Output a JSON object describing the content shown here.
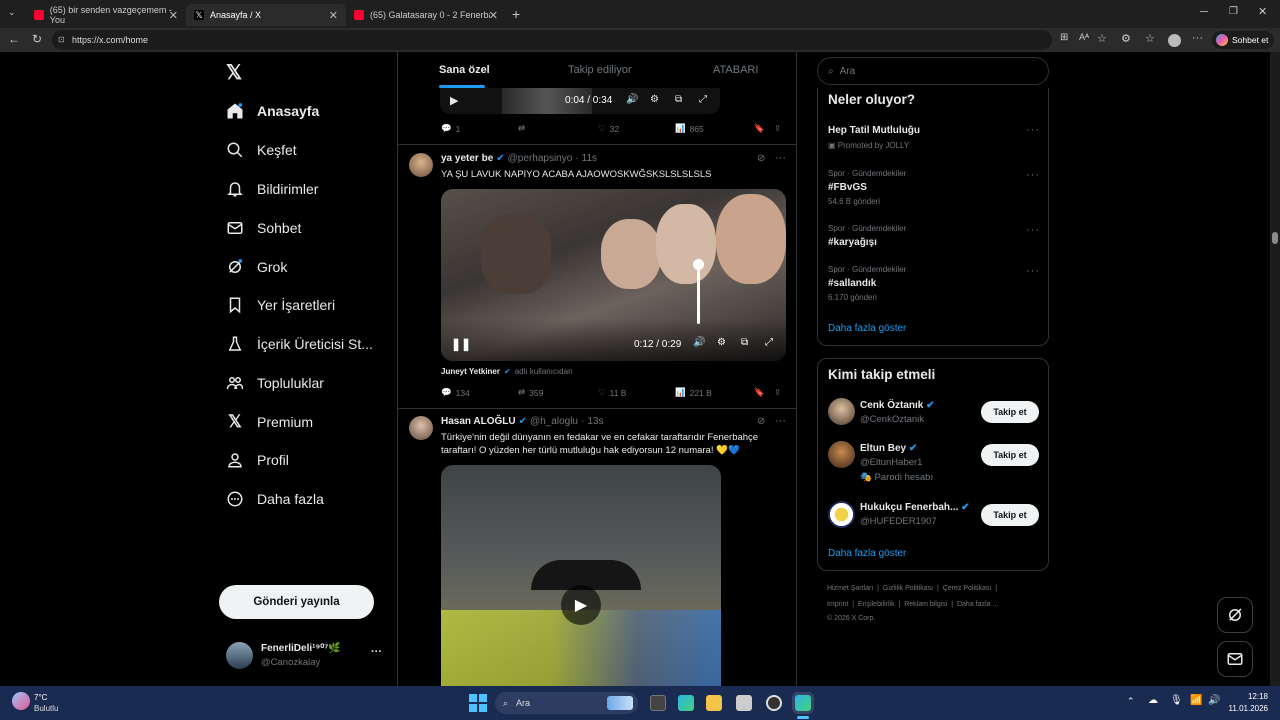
{
  "browser": {
    "tabs": [
      {
        "title": "(65) bir senden vazgeçemem - You",
        "active": false
      },
      {
        "title": "Anasayfa / X",
        "active": true
      },
      {
        "title": "(65) Galatasaray 0 - 2 Fenerbahçe",
        "active": false
      }
    ],
    "url": "https://x.com/home",
    "profile_button": "Sohbet et"
  },
  "nav": {
    "items": [
      {
        "label": "Anasayfa",
        "icon": "home-icon"
      },
      {
        "label": "Keşfet",
        "icon": "search-icon"
      },
      {
        "label": "Bildirimler",
        "icon": "bell-icon"
      },
      {
        "label": "Sohbet",
        "icon": "mail-icon"
      },
      {
        "label": "Grok",
        "icon": "grok-icon"
      },
      {
        "label": "Yer İşaretleri",
        "icon": "bookmark-icon"
      },
      {
        "label": "İçerik Üreticisi St...",
        "icon": "flask-icon"
      },
      {
        "label": "Topluluklar",
        "icon": "people-icon"
      },
      {
        "label": "Premium",
        "icon": "x-logo-icon"
      },
      {
        "label": "Profil",
        "icon": "person-icon"
      },
      {
        "label": "Daha fazla",
        "icon": "more-circle-icon"
      }
    ],
    "post_button": "Gönderi yayınla",
    "account": {
      "name": "FenerliDeli¹⁹⁰⁷🌿",
      "handle": "@Canozkalay"
    }
  },
  "timeline": {
    "tabs": [
      "Sana özel",
      "Takip ediliyor",
      "ATABARI"
    ],
    "top_player": {
      "time": "0:04 / 0:34"
    },
    "top_actions": {
      "replies": "1",
      "retweets": "",
      "likes": "32",
      "views": "865"
    },
    "post1": {
      "name": "ya yeter be",
      "handle": "@perhapsinyo",
      "time": "11s",
      "text": "YA ŞU LAVUK NAPIYO ACABA AJAOWOSKWĞSKSLSLSLSLS",
      "video_time": "0:12 / 0:29",
      "attribution_name": "Juneyt Yetkiner",
      "attribution_suffix": "adlı kullanıcıdan",
      "replies": "134",
      "retweets": "359",
      "likes": "11 B",
      "views": "221 B"
    },
    "post2": {
      "name": "Hasan ALOĞLU",
      "handle": "@h_aloglu",
      "time": "13s",
      "text": "Türkiye'nin değil dünyanın en fedakar ve en cefakar taraftarıdır Fenerbahçe taraftarı! O yüzden her türlü mutluluğu hak ediyorsun 12 numara! 💛💙"
    }
  },
  "sidebar": {
    "search_placeholder": "Ara",
    "trends_title": "Neler oluyor?",
    "trends": [
      {
        "context": "",
        "name": "Hep Tatil Mutluluğu",
        "meta": "Promoted by JOLLY"
      },
      {
        "context": "Spor · Gündemdekiler",
        "name": "#FBvGS",
        "meta": "54,6 B gönderi"
      },
      {
        "context": "Spor · Gündemdekiler",
        "name": "#karyağışı",
        "meta": ""
      },
      {
        "context": "Spor · Gündemdekiler",
        "name": "#sallandık",
        "meta": "6.170 gönderi"
      }
    ],
    "show_more": "Daha fazla göster",
    "who_title": "Kimi takip etmeli",
    "who": [
      {
        "name": "Cenk Öztanık",
        "handle": "@CenkOztanik",
        "note": "",
        "button": "Takip et"
      },
      {
        "name": "Eltun Bey",
        "handle": "@EltunHaber1",
        "note": "Parodi hesabı",
        "button": "Takip et"
      },
      {
        "name": "Hukukçu Fenerbah...",
        "handle": "@HUFEDER1907",
        "note": "",
        "button": "Takip et"
      }
    ],
    "who_more": "Daha fazla göster",
    "footer_line1": [
      "Hizmet Şartları",
      "Gizlilik Politikası",
      "Çerez Politikası"
    ],
    "footer_line2": [
      "Imprint",
      "Erişilebilirlik",
      "Reklam bilgisi",
      "Daha fazla ..."
    ],
    "copyright": "© 2026 X Corp."
  },
  "taskbar": {
    "weather_temp": "7°C",
    "weather_desc": "Bulutlu",
    "search": "Ara",
    "time": "12:18",
    "date": "11.01.2026"
  },
  "colors": {
    "accent": "#1d9bf0",
    "border": "#2f3336",
    "muted": "#71767b",
    "taskbar": "#1a2b52"
  }
}
